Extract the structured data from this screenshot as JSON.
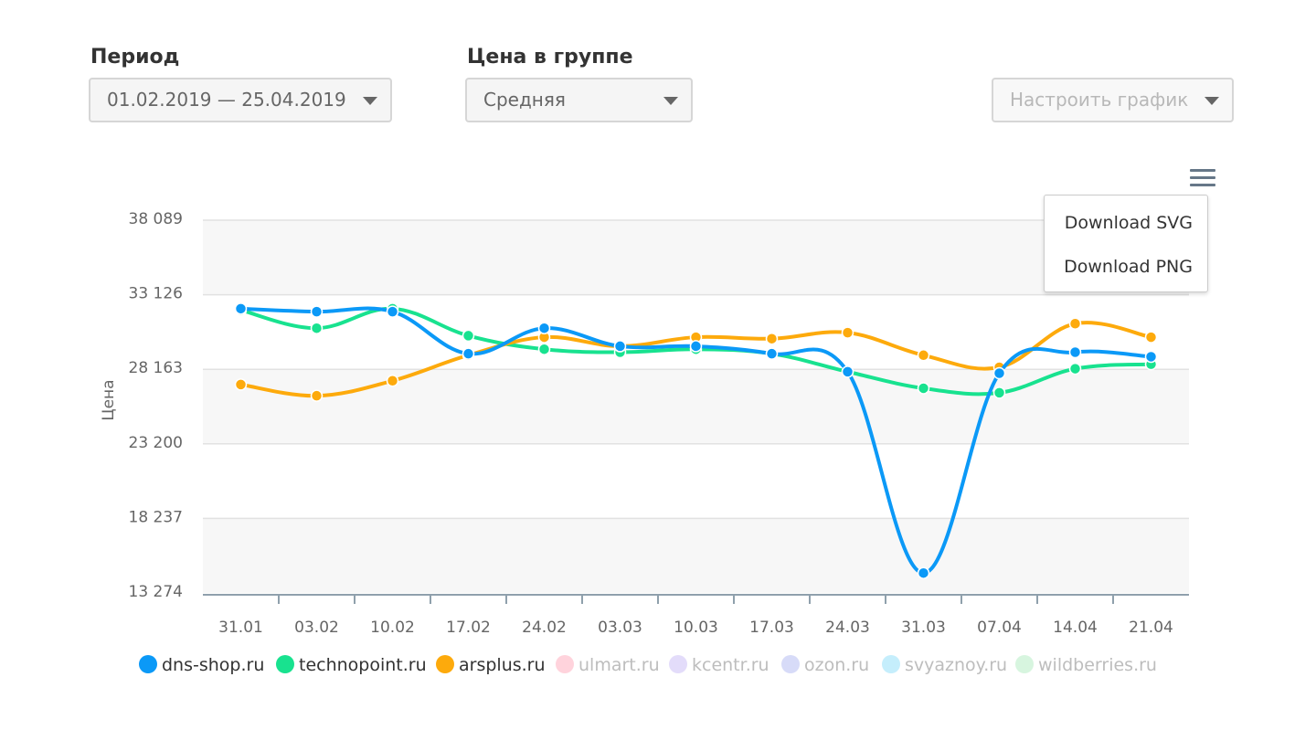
{
  "filters": {
    "period_label": "Период",
    "period_value": "01.02.2019 — 25.04.2019",
    "group_label": "Цена в группе",
    "group_value": "Средняя",
    "configure_label": "Настроить график"
  },
  "export_menu": {
    "icon": "hamburger-menu-icon",
    "items": [
      "Download SVG",
      "Download PNG"
    ]
  },
  "chart_data": {
    "type": "line",
    "ylabel": "Цена",
    "y_ticks": [
      "38 089",
      "33 126",
      "28 163",
      "23 200",
      "18 237",
      "13 274"
    ],
    "ylim": [
      13274,
      38089
    ],
    "categories": [
      "31.01",
      "03.02",
      "10.02",
      "17.02",
      "24.02",
      "03.03",
      "10.03",
      "17.03",
      "24.03",
      "31.03",
      "07.04",
      "14.04",
      "21.04"
    ],
    "grid": true,
    "legend_position": "bottom",
    "series": [
      {
        "name": "technopoint.ru",
        "color": "#18e28f",
        "visible": true,
        "values": [
          32100,
          30900,
          32200,
          30400,
          29500,
          29300,
          29500,
          29200,
          28000,
          26900,
          26600,
          28200,
          28500
        ]
      },
      {
        "name": "arsplus.ru",
        "color": "#fdaa0c",
        "visible": true,
        "values": [
          27150,
          26400,
          27400,
          29100,
          30300,
          29700,
          30300,
          30200,
          30600,
          29100,
          28300,
          31200,
          30300
        ]
      },
      {
        "name": "dns-shop.ru",
        "color": "#0b99f7",
        "visible": true,
        "values": [
          32200,
          32000,
          32000,
          29200,
          30900,
          29700,
          29700,
          29200,
          28000,
          14600,
          27900,
          29300,
          29000
        ]
      },
      {
        "name": "ulmart.ru",
        "color": "#ffd3dc",
        "visible": false,
        "values": []
      },
      {
        "name": "kcentr.ru",
        "color": "#e3dcfa",
        "visible": false,
        "values": []
      },
      {
        "name": "ozon.ru",
        "color": "#d7dbf8",
        "visible": false,
        "values": []
      },
      {
        "name": "svyaznoy.ru",
        "color": "#c5eefc",
        "visible": false,
        "values": []
      },
      {
        "name": "wildberries.ru",
        "color": "#d7f5df",
        "visible": false,
        "values": []
      }
    ],
    "legend_order": [
      "dns-shop.ru",
      "technopoint.ru",
      "arsplus.ru",
      "ulmart.ru",
      "kcentr.ru",
      "ozon.ru",
      "svyaznoy.ru",
      "wildberries.ru"
    ]
  }
}
